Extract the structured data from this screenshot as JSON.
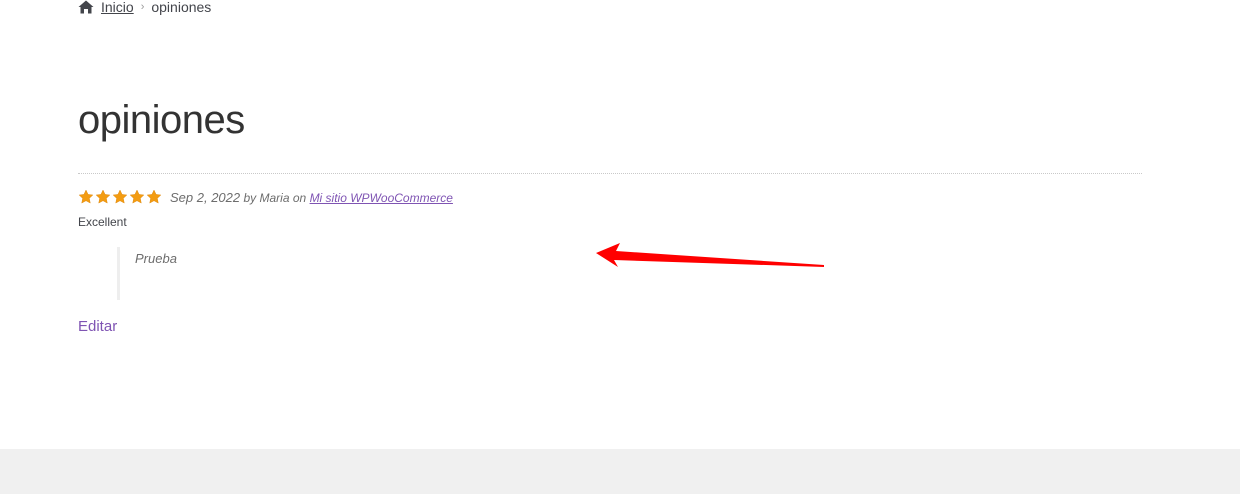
{
  "breadcrumb": {
    "home_label": "Inicio",
    "separator": "›",
    "current": "opiniones"
  },
  "page": {
    "title": "opiniones"
  },
  "review": {
    "rating": 5,
    "rating_max": 5,
    "date": "Sep 2, 2022",
    "by_text": "by",
    "author": "Maria",
    "on_text": "on",
    "site_link": "Mi sitio WPWooCommerce",
    "title": "Excellent",
    "content": "Prueba"
  },
  "actions": {
    "edit_label": "Editar"
  },
  "colors": {
    "link": "#7f54b3",
    "star": "#f39c12",
    "annotation_arrow": "#ff0000",
    "footer": "#f0f0f0"
  },
  "icons": [
    "home-icon",
    "star-icon",
    "arrow-annotation"
  ]
}
